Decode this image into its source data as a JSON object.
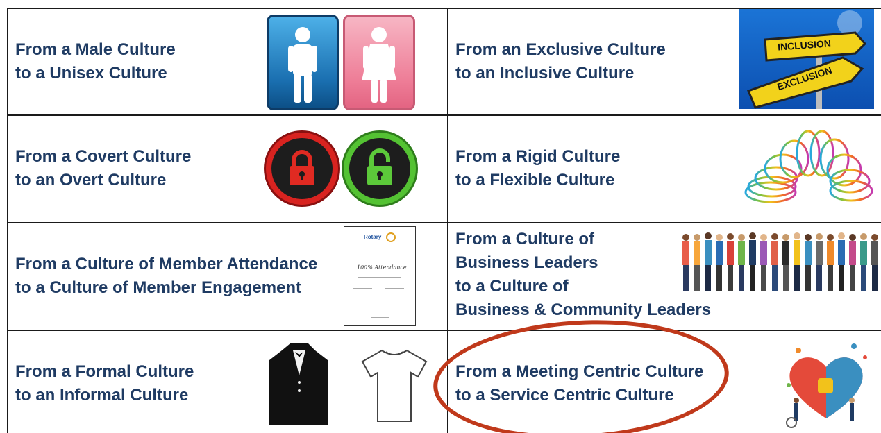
{
  "rows": [
    {
      "left": {
        "line1": "From a Male Culture",
        "line2": "to a Unisex Culture",
        "image": "restroom-signs"
      },
      "right": {
        "line1": "From an Exclusive Culture",
        "line2": "to an Inclusive Culture",
        "image": "inclusion-exclusion-sign",
        "sign_top": "INCLUSION",
        "sign_bottom": "EXCLUSION"
      }
    },
    {
      "left": {
        "line1": "From a Covert Culture",
        "line2": "to an Overt Culture",
        "image": "lock-icons"
      },
      "right": {
        "line1": "From a Rigid Culture",
        "line2": "to a Flexible Culture",
        "image": "slinky-spring"
      }
    },
    {
      "left": {
        "line1": "From a Culture of Member Attendance",
        "line2": "to a Culture of Member Engagement",
        "image": "attendance-certificate",
        "cert_title": "100% Attendance",
        "cert_brand": "Rotary"
      },
      "right": {
        "line1": "From a Culture of",
        "line2": "Business Leaders",
        "line3": "to a Culture of",
        "line4": "Business & Community Leaders",
        "image": "crowd-of-people"
      }
    },
    {
      "left": {
        "line1": "From a Formal Culture",
        "line2": "to an Informal Culture",
        "image": "tuxedo-and-tshirt"
      },
      "right": {
        "line1": "From a Meeting Centric Culture",
        "line2": "to a Service Centric Culture",
        "image": "service-puzzle-heart"
      }
    }
  ],
  "colors": {
    "text": "#1f3b63",
    "highlight": "#c0391b",
    "border": "#1a1a1a"
  }
}
